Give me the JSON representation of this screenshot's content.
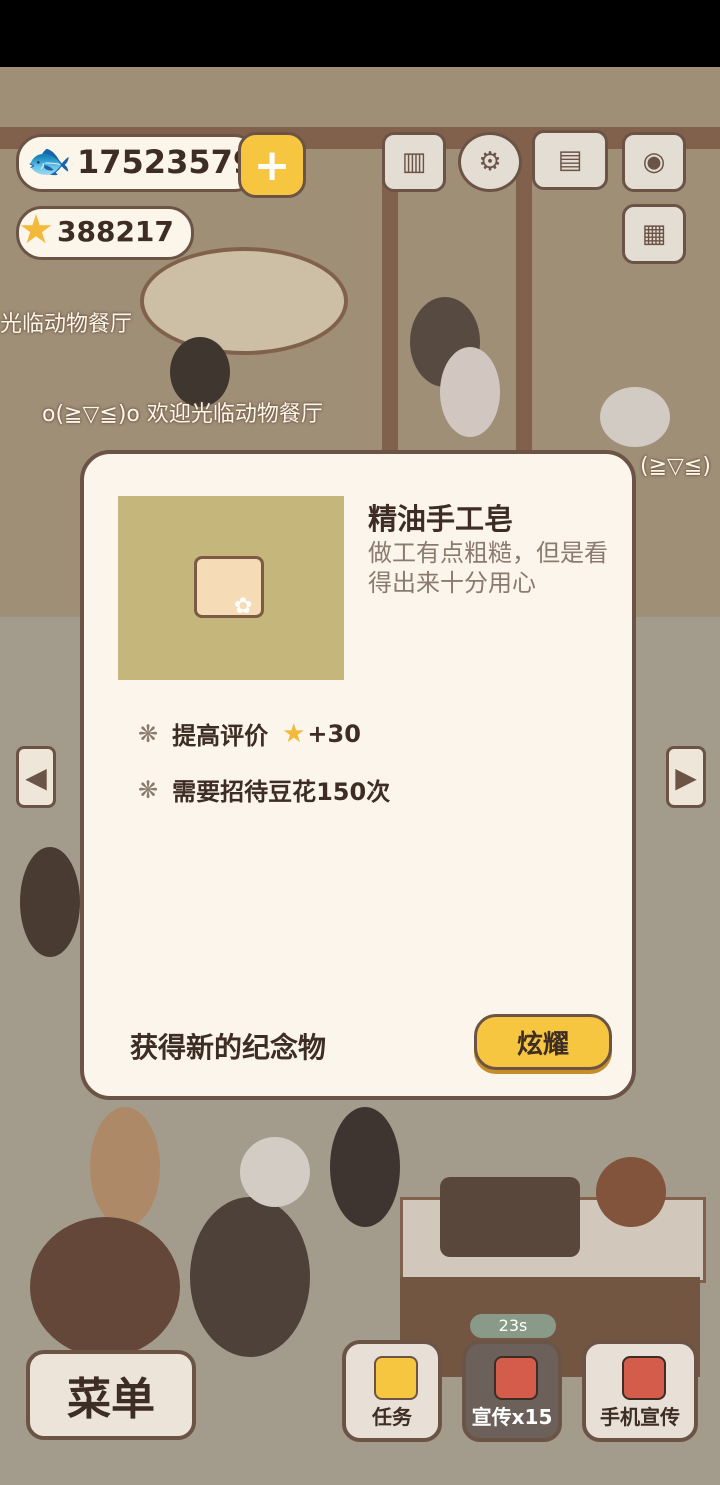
{
  "hud": {
    "fish_count": "17523579",
    "star_count": "388217"
  },
  "scene": {
    "sign_text_1": "光临动物餐厅",
    "sign_text_2": "o(≧▽≦)o 欢迎光临动物餐厅",
    "sign_text_3": "(≧▽≦)"
  },
  "modal": {
    "item_title": "精油手工皂",
    "item_desc": "做工有点粗糙，但是看得出来十分用心",
    "bonus_label": "提高评价",
    "bonus_value": "+30",
    "requirement": "需要招待豆花150次",
    "footer": "获得新的纪念物",
    "share_button": "炫耀"
  },
  "bottom": {
    "menu": "菜单",
    "tasks": "任务",
    "promote": "宣传x15",
    "phone_promote": "手机宣传",
    "timer": "23s"
  },
  "colors": {
    "accent": "#f6c640",
    "outline": "#6b5446",
    "panel": "#fbf5ec"
  }
}
